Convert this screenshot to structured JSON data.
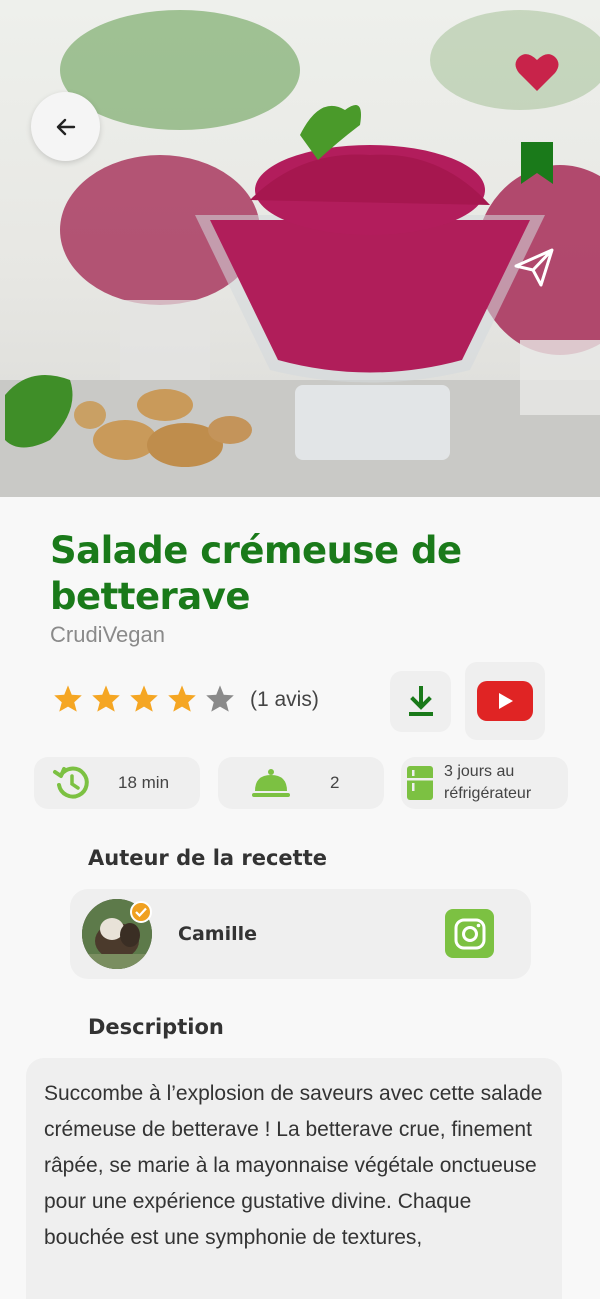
{
  "recipe": {
    "title": "Salade crémeuse de betterave",
    "brand": "CrudiVegan",
    "rating": 4,
    "rating_max": 5,
    "reviews_label": "(1 avis)"
  },
  "info": {
    "time_label": "18 min",
    "servings_label": "2",
    "storage_label": "3 jours au réfrigérateur"
  },
  "author": {
    "section_title": "Auteur de la recette",
    "name": "Camille"
  },
  "description": {
    "section_title": "Description",
    "text": "Succombe à l’explosion de saveurs avec cette salade crémeuse de betterave ! La betterave crue, finement râpée, se marie à la mayonnaise végétale onctueuse pour une expérience gustative divine. Chaque bouchée est une symphonie de textures,"
  },
  "icons": {
    "back": "arrow-left-icon",
    "favorite": "heart-icon",
    "bookmark": "bookmark-icon",
    "share": "send-icon",
    "download": "download-icon",
    "youtube": "youtube-icon",
    "time": "history-icon",
    "servings": "cloche-icon",
    "storage": "fridge-icon",
    "instagram": "instagram-icon",
    "verified": "check-badge-icon"
  },
  "colors": {
    "brand_green": "#1a7a1a",
    "icon_green": "#7cc142",
    "star": "#f5a623",
    "star_empty": "#8a8a8a",
    "heart": "#c8234a",
    "youtube_red": "#e02424"
  }
}
